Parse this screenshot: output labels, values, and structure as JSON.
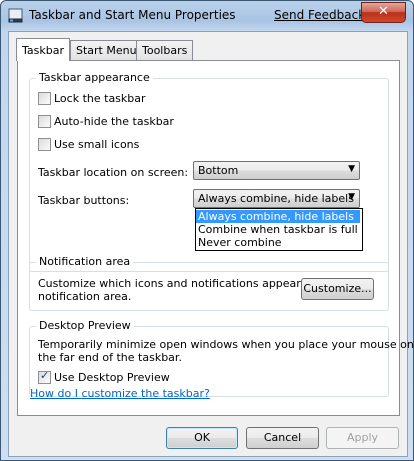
{
  "window": {
    "title": "Taskbar and Start Menu Properties",
    "feedback_link": "Send Feedback",
    "close_glyph": "✕"
  },
  "tabs": [
    {
      "label": "Taskbar",
      "active": true
    },
    {
      "label": "Start Menu",
      "active": false
    },
    {
      "label": "Toolbars",
      "active": false
    }
  ],
  "appearance": {
    "title": "Taskbar appearance",
    "lock": {
      "label": "Lock the taskbar",
      "checked": false
    },
    "autohide": {
      "label": "Auto-hide the taskbar",
      "checked": false
    },
    "small_icons": {
      "label": "Use small icons",
      "checked": false
    },
    "location_label": "Taskbar location on screen:",
    "location_value": "Bottom",
    "buttons_label": "Taskbar buttons:",
    "buttons_value": "Always combine, hide labels",
    "buttons_options": [
      "Always combine, hide labels",
      "Combine when taskbar is full",
      "Never combine"
    ]
  },
  "notification": {
    "title": "Notification area",
    "text_line1": "Customize which icons and notifications appear in the",
    "text_line2": "notification area.",
    "customize_button": "Customize..."
  },
  "preview": {
    "title": "Desktop Preview",
    "text_line1": "Temporarily minimize open windows when you place your mouse on",
    "text_line2": "the far end of the taskbar.",
    "use_preview": {
      "label": "Use Desktop Preview",
      "checked": true
    }
  },
  "help_link": "How do I customize the taskbar?",
  "buttons": {
    "ok": "OK",
    "cancel": "Cancel",
    "apply": "Apply"
  },
  "icons": {
    "check": "✓",
    "dropdown": "▼"
  }
}
